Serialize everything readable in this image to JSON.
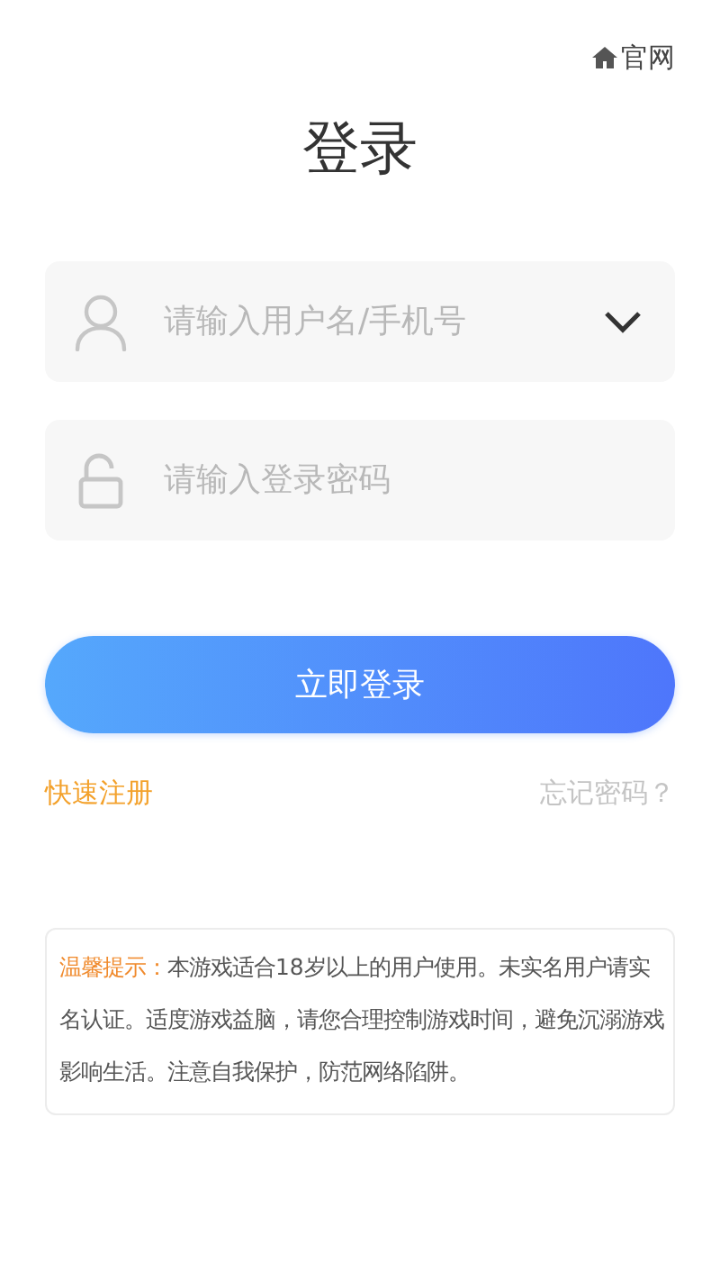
{
  "header": {
    "home_link": "官网"
  },
  "title": "登录",
  "fields": [
    {
      "kind": "account",
      "placeholder": "请输入用户名/手机号"
    },
    {
      "kind": "password",
      "placeholder": "请输入登录密码"
    }
  ],
  "login_button": "立即登录",
  "register_link": "快速注册",
  "forgot_link": "忘记密码？",
  "notice": {
    "label": "温馨提示：",
    "text": "本游戏适合18岁以上的用户使用。未实名用户请实名认证。适度游戏益脑，请您合理控制游戏时间，避免沉溺游戏影响生活。注意自我保护，防范网络陷阱。"
  }
}
